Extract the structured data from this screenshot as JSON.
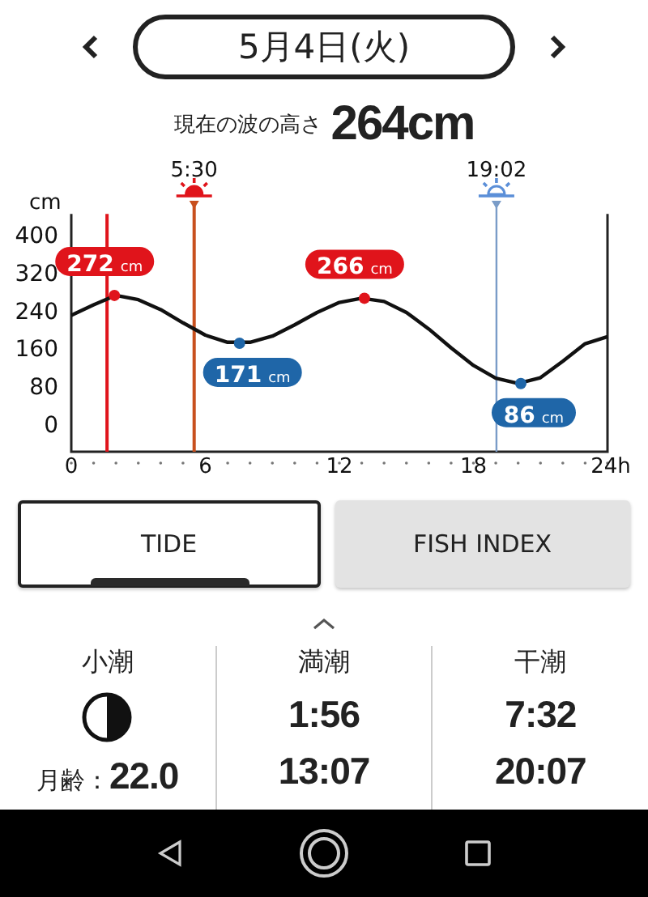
{
  "date": "5月4日(火)",
  "current_height": {
    "label": "現在の波の高さ",
    "value": "264",
    "unit": "cm"
  },
  "chart": {
    "chart_data": {
      "type": "line",
      "ylabel": "cm",
      "xlim": [
        0,
        24
      ],
      "ylim": [
        -58,
        444
      ],
      "yticks": [
        0,
        80,
        160,
        240,
        320,
        400
      ],
      "xticks": [
        0,
        6,
        12,
        18,
        {
          "value": 24,
          "label": "24h"
        }
      ],
      "x": [
        0,
        1,
        2,
        3,
        4,
        5,
        6,
        7,
        8,
        9,
        10,
        11,
        12,
        13,
        14,
        15,
        16,
        17,
        18,
        19,
        20,
        21,
        22,
        23,
        24
      ],
      "series": [
        {
          "color": "#111111",
          "values": [
            230,
            252,
            272,
            263,
            242,
            214,
            188,
            173,
            173,
            186,
            210,
            236,
            257,
            266,
            259,
            236,
            201,
            161,
            124,
            97,
            86,
            98,
            133,
            170,
            185
          ]
        }
      ],
      "ref_lines": [
        {
          "axis": "x",
          "value": 1.6,
          "color": "#e0141b"
        },
        {
          "axis": "x",
          "value": 5.5,
          "color": "#c8501e",
          "label": "5:30"
        },
        {
          "axis": "x",
          "value": 19.03,
          "color": "#7a9cc8",
          "label": "19:02"
        }
      ],
      "annotations": [
        {
          "x": 1.93,
          "y": 272,
          "text": "272 cm"
        },
        {
          "x": 7.53,
          "y": 171,
          "text": "171 cm"
        },
        {
          "x": 13.12,
          "y": 266,
          "text": "266 cm"
        },
        {
          "x": 20.12,
          "y": 86,
          "text": "86 cm"
        }
      ]
    }
  },
  "tabs": [
    {
      "label": "TIDE",
      "selected": true
    },
    {
      "label": "FISH INDEX",
      "selected": false
    }
  ],
  "summary": [
    {
      "kind": "moon",
      "title": "小潮",
      "moon_age_label": "月齢：",
      "moon_age": "22.0"
    },
    {
      "kind": "times",
      "title": "満潮",
      "times": [
        "1:56",
        "13:07"
      ]
    },
    {
      "kind": "times",
      "title": "干潮",
      "times": [
        "7:32",
        "20:07"
      ]
    }
  ]
}
